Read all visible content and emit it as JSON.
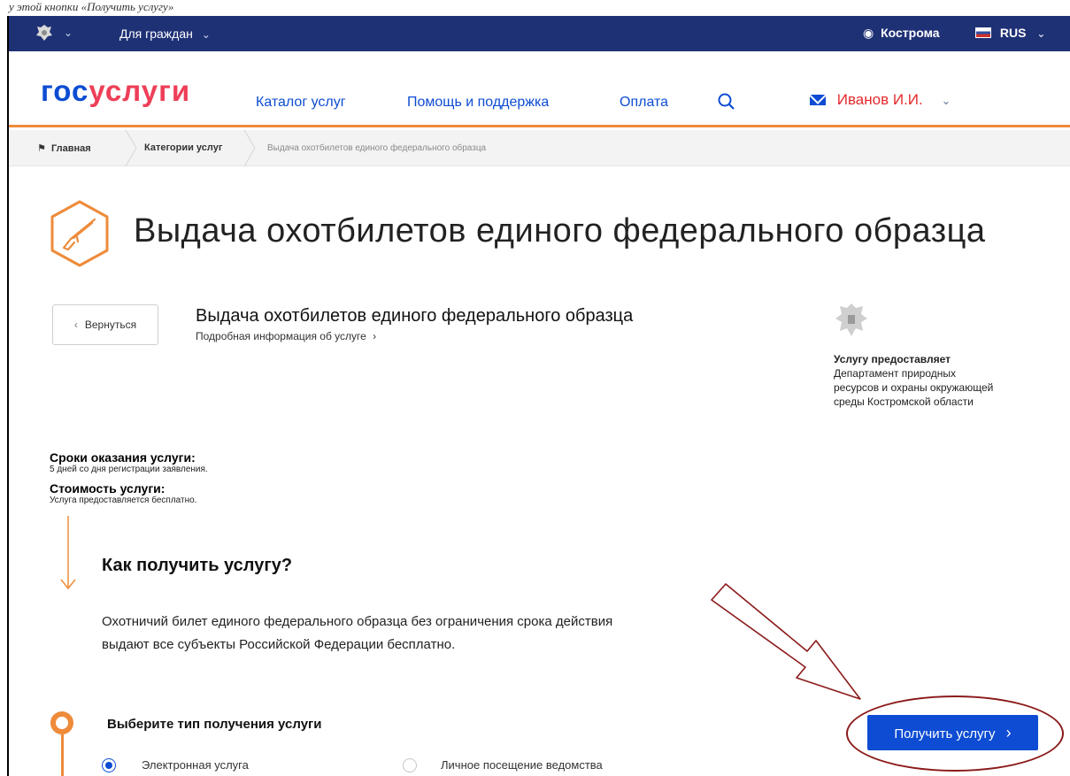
{
  "page_hint": "у этой кнопки «Получить услугу»",
  "topbar": {
    "for_citizens": "Для граждан",
    "location": "Кострома",
    "language": "RUS"
  },
  "header": {
    "logo_gos": "гос",
    "logo_uslugi": "услуги",
    "nav": [
      "Каталог услуг",
      "Помощь и поддержка",
      "Оплата"
    ],
    "user_name": "Иванов И.И."
  },
  "breadcrumbs": {
    "home": "Главная",
    "categories": "Категории услуг",
    "current": "Выдача охотбилетов единого федерального образца"
  },
  "page_title": "Выдача охотбилетов единого федерального образца",
  "service": {
    "back": "Вернуться",
    "title": "Выдача охотбилетов единого федерального образца",
    "more_info": "Подробная информация об услуге",
    "provider_heading": "Услугу предоставляет",
    "provider_lines": [
      "Департамент природных",
      "ресурсов и охраны окружающей",
      "среды Костромской области"
    ]
  },
  "terms": {
    "deadline_heading": "Сроки оказания услуги:",
    "deadline_value": "5 дней со дня регистрации заявления.",
    "cost_heading": "Стоимость услуги:",
    "cost_value": "Услуга предоставляется бесплатно."
  },
  "how": {
    "title": "Как получить услугу?",
    "line1": "Охотничий билет единого федерального образца без ограничения срока действия",
    "line2": "выдают все субъекты Российской Федерации бесплатно."
  },
  "step": {
    "title": "Выберите тип получения услуги",
    "options": [
      "Электронная услуга",
      "Личное посещение ведомства"
    ],
    "selected": "Электронная услуга"
  },
  "cta_label": "Получить услугу",
  "colors": {
    "topbar": "#1f3175",
    "accent": "#ee8b3a",
    "brand_blue": "#0d4cd3",
    "brand_red": "#ee3f58",
    "annotation": "#8b1a1a"
  }
}
